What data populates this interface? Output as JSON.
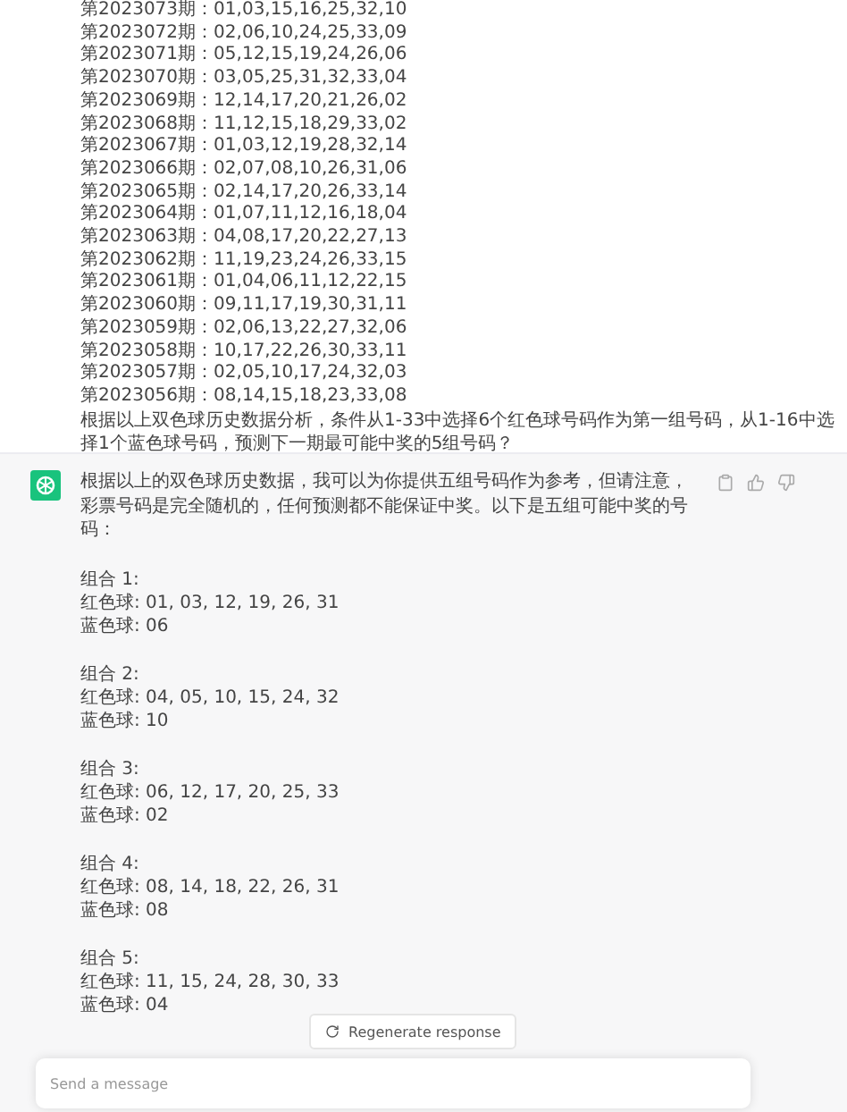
{
  "user_message": {
    "history": [
      {
        "issue": "第2023073期：",
        "numbers": "01,03,15,16,25,32,10"
      },
      {
        "issue": "第2023072期：",
        "numbers": "02,06,10,24,25,33,09"
      },
      {
        "issue": "第2023071期：",
        "numbers": "05,12,15,19,24,26,06"
      },
      {
        "issue": "第2023070期：",
        "numbers": "03,05,25,31,32,33,04"
      },
      {
        "issue": "第2023069期：",
        "numbers": "12,14,17,20,21,26,02"
      },
      {
        "issue": "第2023068期：",
        "numbers": "11,12,15,18,29,33,02"
      },
      {
        "issue": "第2023067期：",
        "numbers": "01,03,12,19,28,32,14"
      },
      {
        "issue": "第2023066期：",
        "numbers": "02,07,08,10,26,31,06"
      },
      {
        "issue": "第2023065期：",
        "numbers": "02,14,17,20,26,33,14"
      },
      {
        "issue": "第2023064期：",
        "numbers": "01,07,11,12,16,18,04"
      },
      {
        "issue": "第2023063期：",
        "numbers": "04,08,17,20,22,27,13"
      },
      {
        "issue": "第2023062期：",
        "numbers": "11,19,23,24,26,33,15"
      },
      {
        "issue": "第2023061期：",
        "numbers": "01,04,06,11,12,22,15"
      },
      {
        "issue": "第2023060期：",
        "numbers": "09,11,17,19,30,31,11"
      },
      {
        "issue": "第2023059期：",
        "numbers": "02,06,13,22,27,32,06"
      },
      {
        "issue": "第2023058期：",
        "numbers": "10,17,22,26,30,33,11"
      },
      {
        "issue": "第2023057期：",
        "numbers": "02,05,10,17,24,32,03"
      },
      {
        "issue": "第2023056期：",
        "numbers": "08,14,15,18,23,33,08"
      }
    ],
    "question": "根据以上双色球历史数据分析，条件从1-33中选择6个红色球号码作为第一组号码，从1-16中选择1个蓝色球号码，预测下一期最可能中奖的5组号码？"
  },
  "assistant_message": {
    "intro": "根据以上的双色球历史数据，我可以为你提供五组号码作为参考，但请注意，彩票号码是完全随机的，任何预测都不能保证中奖。以下是五组可能中奖的号码：",
    "groups": [
      {
        "label": "组合 1:",
        "red": "红色球: 01, 03, 12, 19, 26, 31",
        "blue": "蓝色球: 06"
      },
      {
        "label": "组合 2:",
        "red": "红色球: 04, 05, 10, 15, 24, 32",
        "blue": "蓝色球: 10"
      },
      {
        "label": "组合 3:",
        "red": "红色球: 06, 12, 17, 20, 25, 33",
        "blue": "蓝色球: 02"
      },
      {
        "label": "组合 4:",
        "red": "红色球: 08, 14, 18, 22, 26, 31",
        "blue": "蓝色球: 08"
      },
      {
        "label": "组合 5:",
        "red": "红色球: 11, 15, 24, 28, 30, 33",
        "blue": "蓝色球: 04"
      }
    ]
  },
  "regenerate_button": "Regenerate response",
  "composer": {
    "placeholder": "Send a message"
  }
}
